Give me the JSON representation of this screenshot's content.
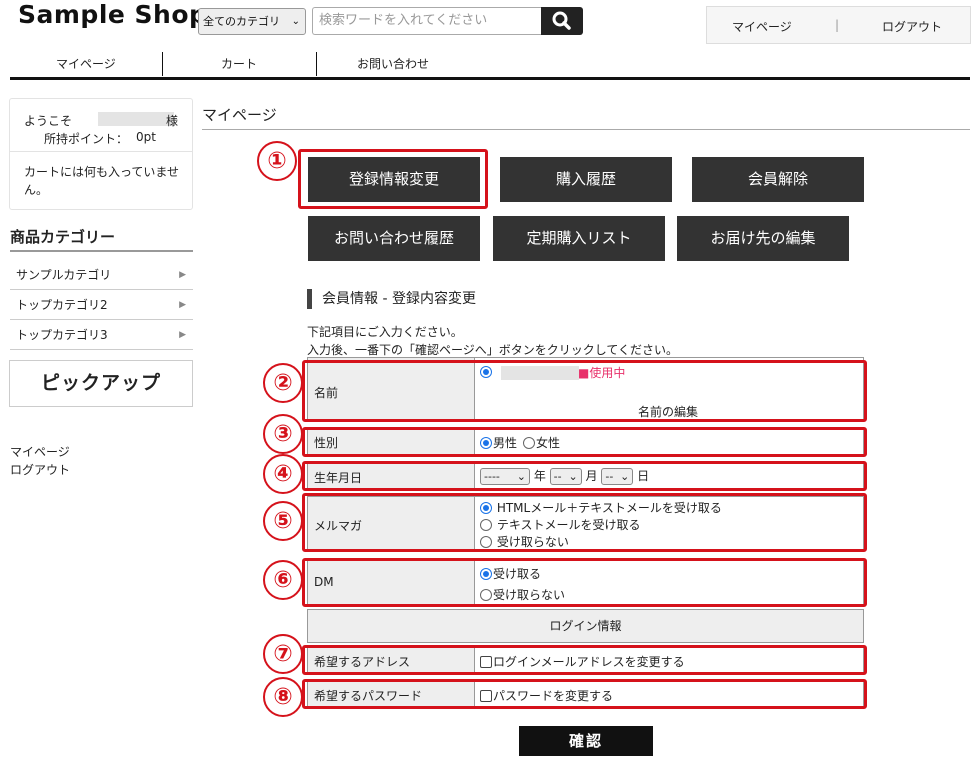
{
  "header": {
    "logo": "Sample Shop",
    "category_select": "全てのカテゴリ",
    "search_placeholder": "検索ワードを入れてください",
    "mypage": "マイページ",
    "separator": "|",
    "logout": "ログアウト"
  },
  "nav": {
    "items": [
      "マイページ",
      "カート",
      "お問い合わせ"
    ]
  },
  "sidebar": {
    "welcome": "ようこそ",
    "honorific": "様",
    "points_label": "所持ポイント：",
    "points_value": "0pt",
    "cart_empty": "カートには何も入っていません。",
    "category_title": "商品カテゴリー",
    "categories": [
      "サンプルカテゴリ",
      "トップカテゴリ2",
      "トップカテゴリ3"
    ],
    "arrow": "▶",
    "pickup": "ピックアップ",
    "links": [
      "マイページ",
      "ログアウト"
    ]
  },
  "main": {
    "title": "マイページ",
    "buttons": [
      "登録情報変更",
      "購入履歴",
      "会員解除",
      "お問い合わせ履歴",
      "定期購入リスト",
      "お届け先の編集"
    ],
    "section_title": "会員情報 - 登録内容変更",
    "instructions": [
      "下記項目にご入力ください。",
      "入力後、一番下の「確認ページへ」ボタンをクリックしてください。"
    ],
    "name": {
      "label": "名前",
      "in_use": "■使用中",
      "edit": "名前の編集"
    },
    "gender": {
      "label": "性別",
      "options": [
        "男性",
        "女性"
      ]
    },
    "birthday": {
      "label": "生年月日",
      "year": "----",
      "month": "--",
      "day": "--",
      "year_unit": "年",
      "month_unit": "月",
      "day_unit": "日"
    },
    "mailmag": {
      "label": "メルマガ",
      "options": [
        "HTMLメール＋テキストメールを受け取る",
        "テキストメールを受け取る",
        "受け取らない"
      ]
    },
    "dm": {
      "label": "DM",
      "options": [
        "受け取る",
        "受け取らない"
      ]
    },
    "login_info": "ログイン情報",
    "address": {
      "label": "希望するアドレス",
      "option": "ログインメールアドレスを変更する"
    },
    "password": {
      "label": "希望するパスワード",
      "option": "パスワードを変更する"
    },
    "confirm": "確認"
  },
  "annotations": [
    "①",
    "②",
    "③",
    "④",
    "⑤",
    "⑥",
    "⑦",
    "⑧"
  ],
  "colors": {
    "annotation_red": "#d5121b",
    "button_dark": "#333333",
    "radio_blue": "#1a73e8"
  }
}
